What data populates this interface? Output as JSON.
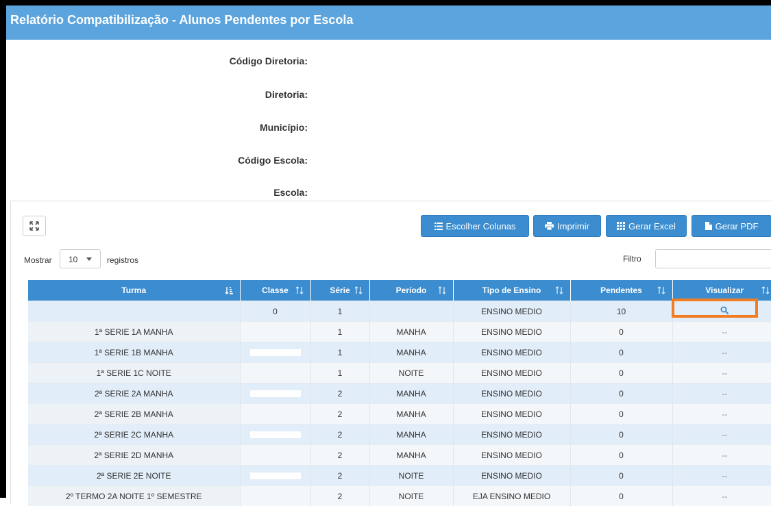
{
  "header": {
    "title": "Relatório Compatibilização - Alunos Pendentes por Escola"
  },
  "info": [
    {
      "label": "Código Diretoria:"
    },
    {
      "label": "Diretoria:"
    },
    {
      "label": "Município:"
    },
    {
      "label": "Código Escola:"
    },
    {
      "label": "Escola:"
    }
  ],
  "toolbar": {
    "choose_columns": "Escolher Colunas",
    "print": "Imprimir",
    "excel": "Gerar Excel",
    "pdf": "Gerar PDF"
  },
  "length": {
    "show": "Mostrar",
    "value": "10",
    "records": "registros"
  },
  "filter": {
    "label": "Filtro",
    "value": ""
  },
  "table": {
    "columns": [
      "Turma",
      "Classe",
      "Série",
      "Período",
      "Tipo de Ensino",
      "Pendentes",
      "Visualizar"
    ],
    "rows": [
      {
        "turma": "",
        "classe": "0",
        "serie": "1",
        "periodo": "",
        "tipo": "ENSINO MEDIO",
        "pendentes": "10",
        "visualizar": "search-icon"
      },
      {
        "turma": "1ª SERIE 1A MANHA",
        "classe": "",
        "serie": "1",
        "periodo": "MANHA",
        "tipo": "ENSINO MEDIO",
        "pendentes": "0",
        "visualizar": "--"
      },
      {
        "turma": "1ª SERIE 1B MANHA",
        "classe": "",
        "serie": "1",
        "periodo": "MANHA",
        "tipo": "ENSINO MEDIO",
        "pendentes": "0",
        "visualizar": "--"
      },
      {
        "turma": "1ª SERIE 1C NOITE",
        "classe": "",
        "serie": "1",
        "periodo": "NOITE",
        "tipo": "ENSINO MEDIO",
        "pendentes": "0",
        "visualizar": "--"
      },
      {
        "turma": "2ª SERIE 2A MANHA",
        "classe": "",
        "serie": "2",
        "periodo": "MANHA",
        "tipo": "ENSINO MEDIO",
        "pendentes": "0",
        "visualizar": "--"
      },
      {
        "turma": "2ª SERIE 2B MANHA",
        "classe": "",
        "serie": "2",
        "periodo": "MANHA",
        "tipo": "ENSINO MEDIO",
        "pendentes": "0",
        "visualizar": "--"
      },
      {
        "turma": "2ª SERIE 2C MANHA",
        "classe": "",
        "serie": "2",
        "periodo": "MANHA",
        "tipo": "ENSINO MEDIO",
        "pendentes": "0",
        "visualizar": "--"
      },
      {
        "turma": "2ª SERIE 2D MANHA",
        "classe": "",
        "serie": "2",
        "periodo": "MANHA",
        "tipo": "ENSINO MEDIO",
        "pendentes": "0",
        "visualizar": "--"
      },
      {
        "turma": "2ª SERIE 2E NOITE",
        "classe": "",
        "serie": "2",
        "periodo": "NOITE",
        "tipo": "ENSINO MEDIO",
        "pendentes": "0",
        "visualizar": "--"
      },
      {
        "turma": "2º TERMO 2A NOITE 1º SEMESTRE",
        "classe": "",
        "serie": "2",
        "periodo": "NOITE",
        "tipo": "EJA ENSINO MEDIO",
        "pendentes": "0",
        "visualizar": "--"
      }
    ]
  },
  "colors": {
    "header_bg": "#5ba4dd",
    "button_bg": "#3c8dcf",
    "highlight": "#f47c20",
    "row_odd": "#e1edf8",
    "row_even": "#f4f7fa"
  }
}
